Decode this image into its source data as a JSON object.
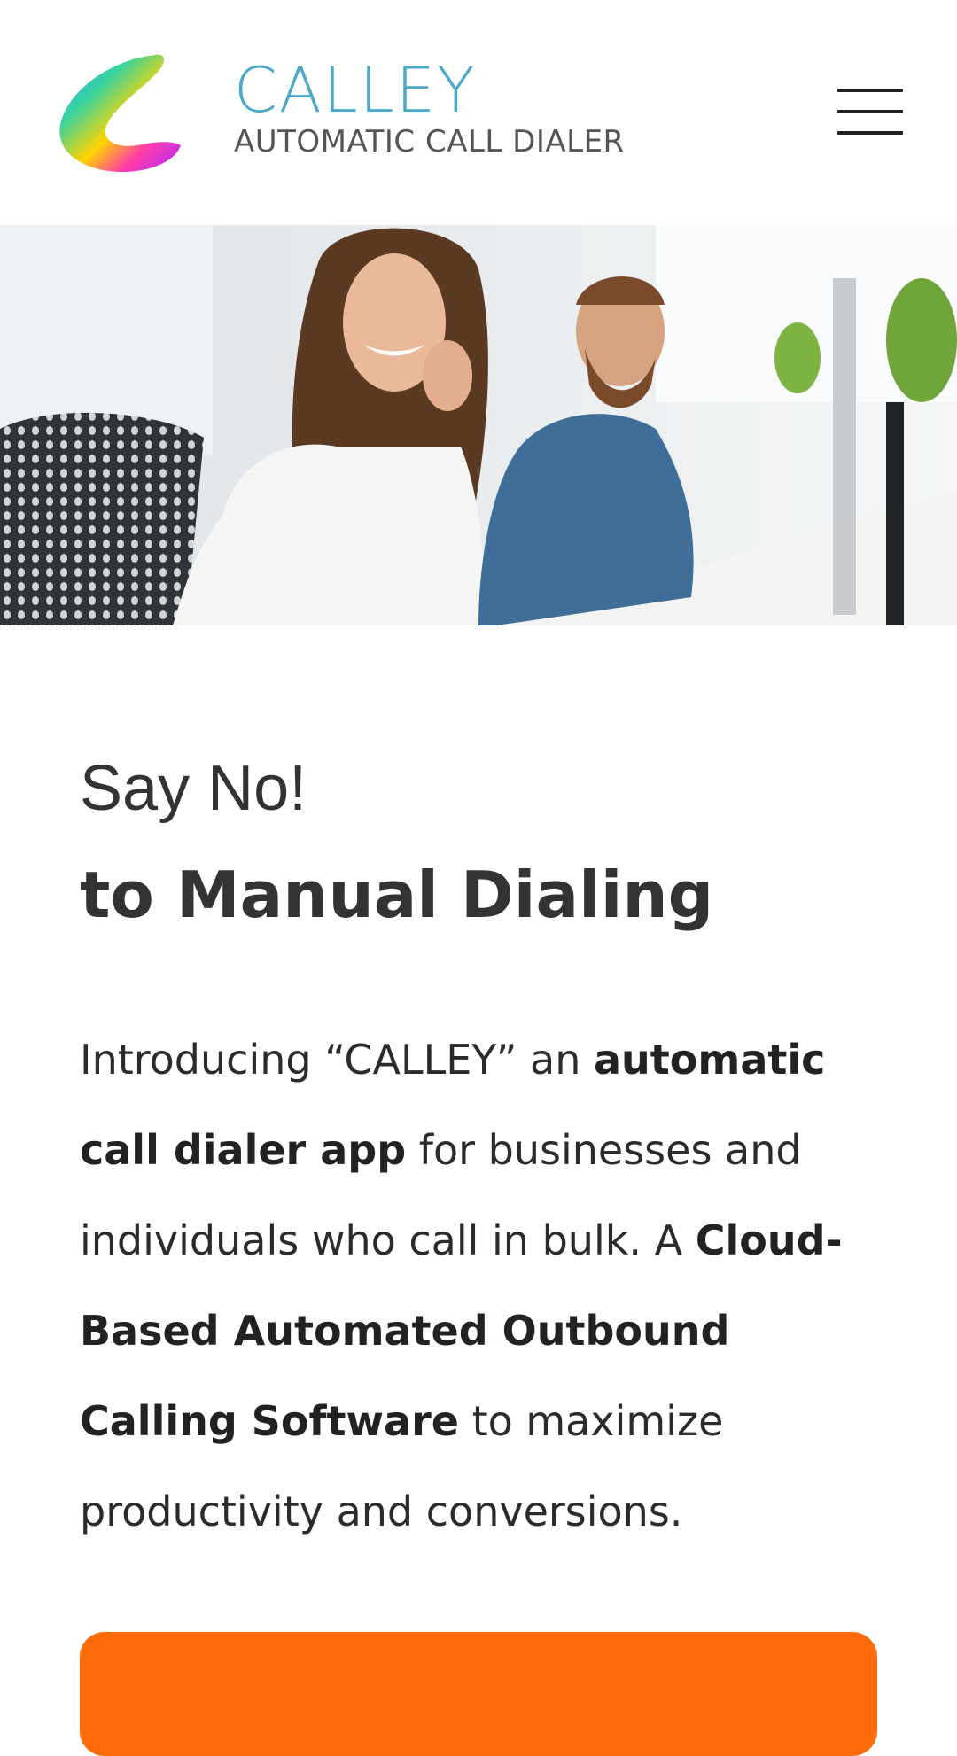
{
  "brand": {
    "name": "CALLEY",
    "tagline": "AUTOMATIC CALL DIALER"
  },
  "hero": {
    "alt": "Smiling call center agent wearing a headset with colleague in background"
  },
  "headline": {
    "line1": "Say No!",
    "line2_prefix": "to ",
    "line2_bold": "Manual Dialing"
  },
  "intro": {
    "p1": "Introducing “CALLEY” an ",
    "b1": "automatic call dialer app",
    "p2": " for businesses and individuals who call in bulk. A ",
    "b2": "Cloud-Based Automated Outbound Calling Software",
    "p3": " to maximize productivity and conversions."
  },
  "colors": {
    "accent": "#ff6a0a",
    "brand": "#4aa8c9"
  },
  "icons": {
    "menu": "hamburger-menu-icon",
    "logo": "calley-swirl-logo"
  }
}
